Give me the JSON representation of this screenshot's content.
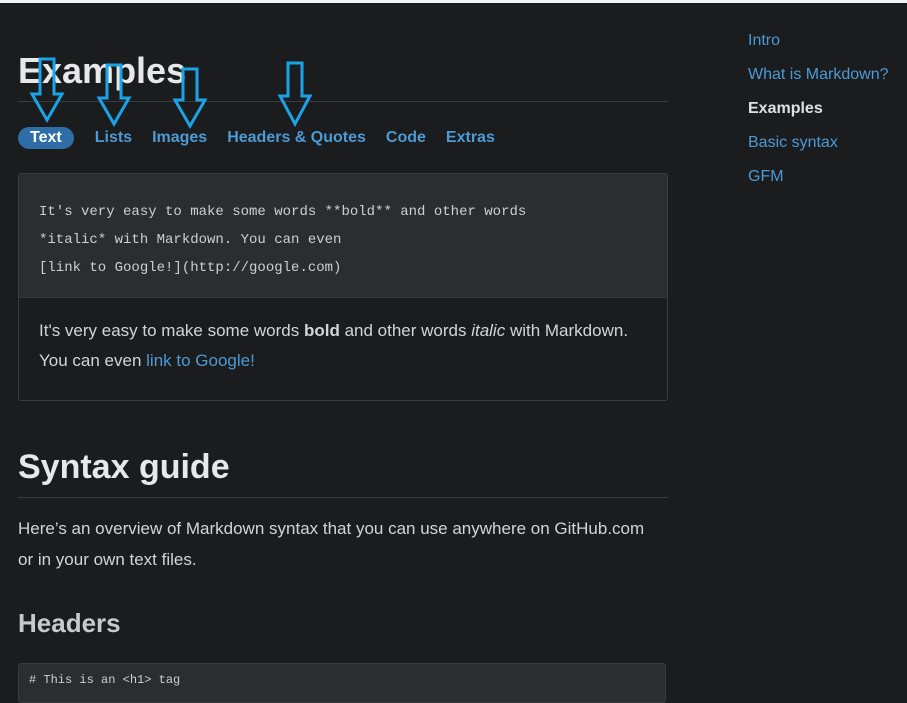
{
  "page": {
    "title": "Examples"
  },
  "tabs": [
    {
      "label": "Text",
      "active": true
    },
    {
      "label": "Lists"
    },
    {
      "label": "Images"
    },
    {
      "label": "Headers & Quotes"
    },
    {
      "label": "Code"
    },
    {
      "label": "Extras"
    }
  ],
  "example": {
    "code_lines": [
      "It's very easy to make some words **bold** and other words",
      "*italic* with Markdown. You can even",
      "[link to Google!](http://google.com)"
    ],
    "rendered": {
      "part1": "It's very easy to make some words ",
      "bold": "bold",
      "part2": " and other words ",
      "italic": "italic",
      "part3": " with Markdown. You can even ",
      "link": "link to Google!"
    }
  },
  "syntax": {
    "title": "Syntax guide",
    "overview": "Here’s an overview of Markdown syntax that you can use anywhere on GitHub.com or in your own text files."
  },
  "headers": {
    "title": "Headers",
    "code_line": "# This is an <h1> tag"
  },
  "sidenav": [
    {
      "label": "Intro"
    },
    {
      "label": "What is Markdown?"
    },
    {
      "label": "Examples",
      "current": true
    },
    {
      "label": "Basic syntax"
    },
    {
      "label": "GFM"
    }
  ],
  "colors": {
    "background": "#1b1c1e",
    "link": "#4c9ad6",
    "active_tab": "#2f6da8",
    "arrow": "#1aa3e8"
  },
  "icons": {
    "annotation": "down-arrow-icon"
  }
}
